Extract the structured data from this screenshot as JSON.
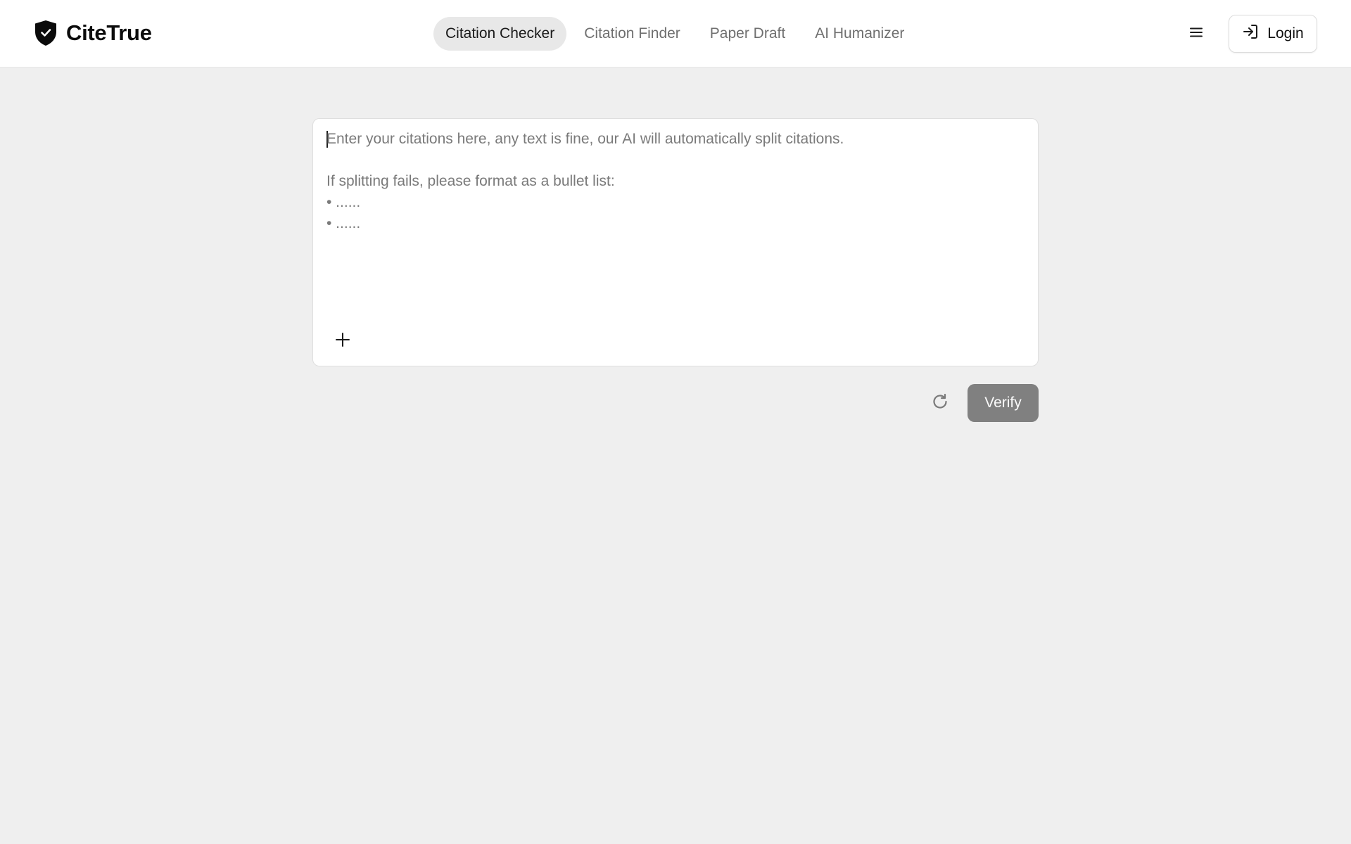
{
  "brand": {
    "name": "CiteTrue",
    "logo_icon": "shield-check-icon"
  },
  "nav": {
    "tabs": [
      {
        "label": "Citation Checker",
        "active": true
      },
      {
        "label": "Citation Finder",
        "active": false
      },
      {
        "label": "Paper Draft",
        "active": false
      },
      {
        "label": "AI Humanizer",
        "active": false
      }
    ]
  },
  "header_actions": {
    "menu_icon": "hamburger-menu-icon",
    "login_label": "Login",
    "login_icon": "login-arrow-icon"
  },
  "editor": {
    "value": "",
    "placeholder_lines": [
      "Enter your citations here, any text is fine, our AI will automatically split citations.",
      "",
      "If splitting fails, please format as a bullet list:",
      "• ......",
      "• ......"
    ],
    "add_icon": "plus-icon"
  },
  "actions": {
    "reset_icon": "refresh-icon",
    "verify_label": "Verify"
  },
  "colors": {
    "page_background": "#efefef",
    "header_background": "#ffffff",
    "active_tab_background": "#e8e8e8",
    "verify_button_background": "#808080",
    "placeholder_text": "#7a7a7a"
  }
}
